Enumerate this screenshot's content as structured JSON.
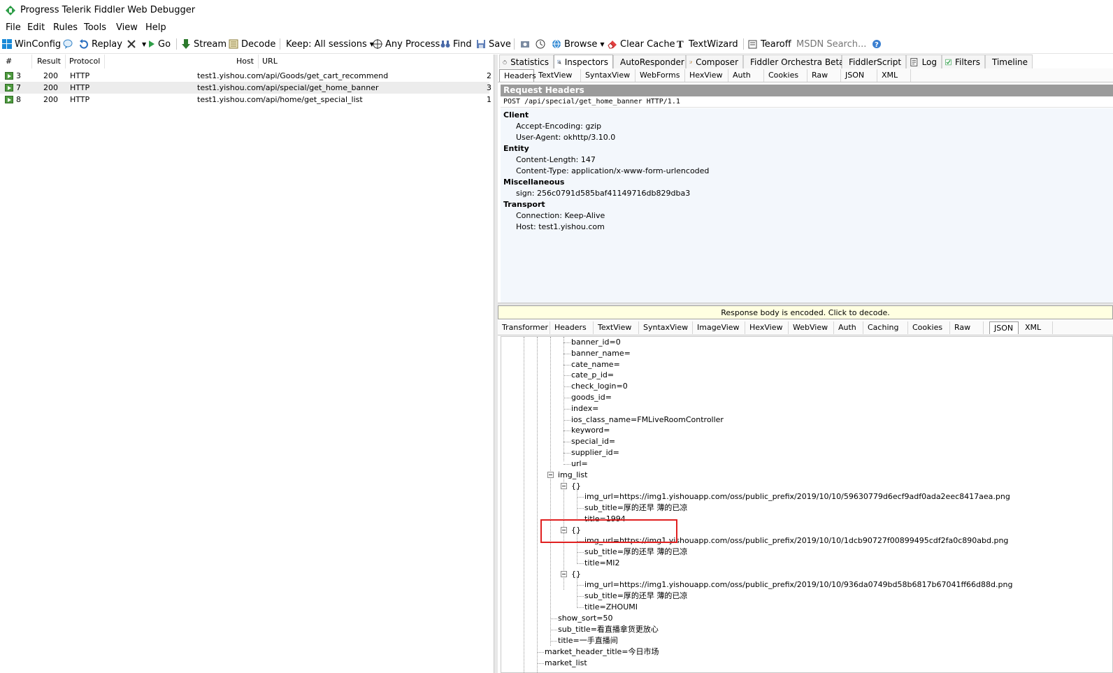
{
  "window": {
    "title": "Progress Telerik Fiddler Web Debugger"
  },
  "menu": [
    "File",
    "Edit",
    "Rules",
    "Tools",
    "View",
    "Help"
  ],
  "toolbar": {
    "winconfig": "WinConfig",
    "replay": "Replay",
    "go": "Go",
    "stream": "Stream",
    "decode": "Decode",
    "keep": "Keep: All sessions",
    "any_process": "Any Process",
    "find": "Find",
    "save": "Save",
    "browse": "Browse",
    "clear_cache": "Clear Cache",
    "textwizard": "TextWizard",
    "tearoff": "Tearoff",
    "msdn_search": "MSDN Search..."
  },
  "sessions": {
    "columns": [
      "#",
      "Result",
      "Protocol",
      "Host",
      "URL"
    ],
    "rows": [
      {
        "id": "3",
        "result": "200",
        "protocol": "HTTP",
        "host": "test1.yishou.com",
        "url": "/api/Goods/get_cart_recommend",
        "extra": "2"
      },
      {
        "id": "7",
        "result": "200",
        "protocol": "HTTP",
        "host": "test1.yishou.com",
        "url": "/api/special/get_home_banner",
        "extra": "3"
      },
      {
        "id": "8",
        "result": "200",
        "protocol": "HTTP",
        "host": "test1.yishou.com",
        "url": "/api/home/get_special_list",
        "extra": "1"
      }
    ]
  },
  "main_tabs": [
    "Statistics",
    "Inspectors",
    "AutoResponder",
    "Composer",
    "Fiddler Orchestra Beta",
    "FiddlerScript",
    "Log",
    "Filters",
    "Timeline"
  ],
  "request_tabs": [
    "Headers",
    "TextView",
    "SyntaxView",
    "WebForms",
    "HexView",
    "Auth",
    "Cookies",
    "Raw",
    "JSON",
    "XML"
  ],
  "request": {
    "section_title": "Request Headers",
    "request_line": "POST /api/special/get_home_banner HTTP/1.1",
    "groups": [
      {
        "name": "Client",
        "lines": [
          "Accept-Encoding: gzip",
          "User-Agent: okhttp/3.10.0"
        ]
      },
      {
        "name": "Entity",
        "lines": [
          "Content-Length: 147",
          "Content-Type: application/x-www-form-urlencoded"
        ]
      },
      {
        "name": "Miscellaneous",
        "lines": [
          "sign: 256c0791d585baf41149716db829dba3"
        ]
      },
      {
        "name": "Transport",
        "lines": [
          "Connection: Keep-Alive",
          "Host: test1.yishou.com"
        ]
      }
    ]
  },
  "response": {
    "encoded_notice": "Response body is encoded. Click to decode.",
    "tabs": [
      "Transformer",
      "Headers",
      "TextView",
      "SyntaxView",
      "ImageView",
      "HexView",
      "WebView",
      "Auth",
      "Caching",
      "Cookies",
      "Raw",
      "JSON",
      "XML"
    ],
    "tree": [
      "banner_id=0",
      "banner_name=",
      "cate_name=",
      "cate_p_id=",
      "check_login=0",
      "goods_id=",
      "index=",
      "ios_class_name=FMLiveRoomController",
      "keyword=",
      "special_id=",
      "supplier_id=",
      "url=",
      "img_list",
      "{}",
      "img_url=https://img1.yishouapp.com/oss/public_prefix/2019/10/10/59630779d6ecf9adf0ada2eec8417aea.png",
      "sub_title=厚的还早 薄的已凉",
      "title=1994",
      "{}",
      "img_url=https://img1.yishouapp.com/oss/public_prefix/2019/10/10/1dcb90727f00899495cdf2fa0c890abd.png",
      "sub_title=厚的还早 薄的已凉",
      "title=MI2",
      "{}",
      "img_url=https://img1.yishouapp.com/oss/public_prefix/2019/10/10/936da0749bd58b6817b67041ff66d88d.png",
      "sub_title=厚的还早 薄的已凉",
      "title=ZHOUMI",
      "show_sort=50",
      "sub_title=看直播拿货更放心",
      "title=一手直播间",
      "market_header_title=今日市场",
      "market_list"
    ]
  }
}
